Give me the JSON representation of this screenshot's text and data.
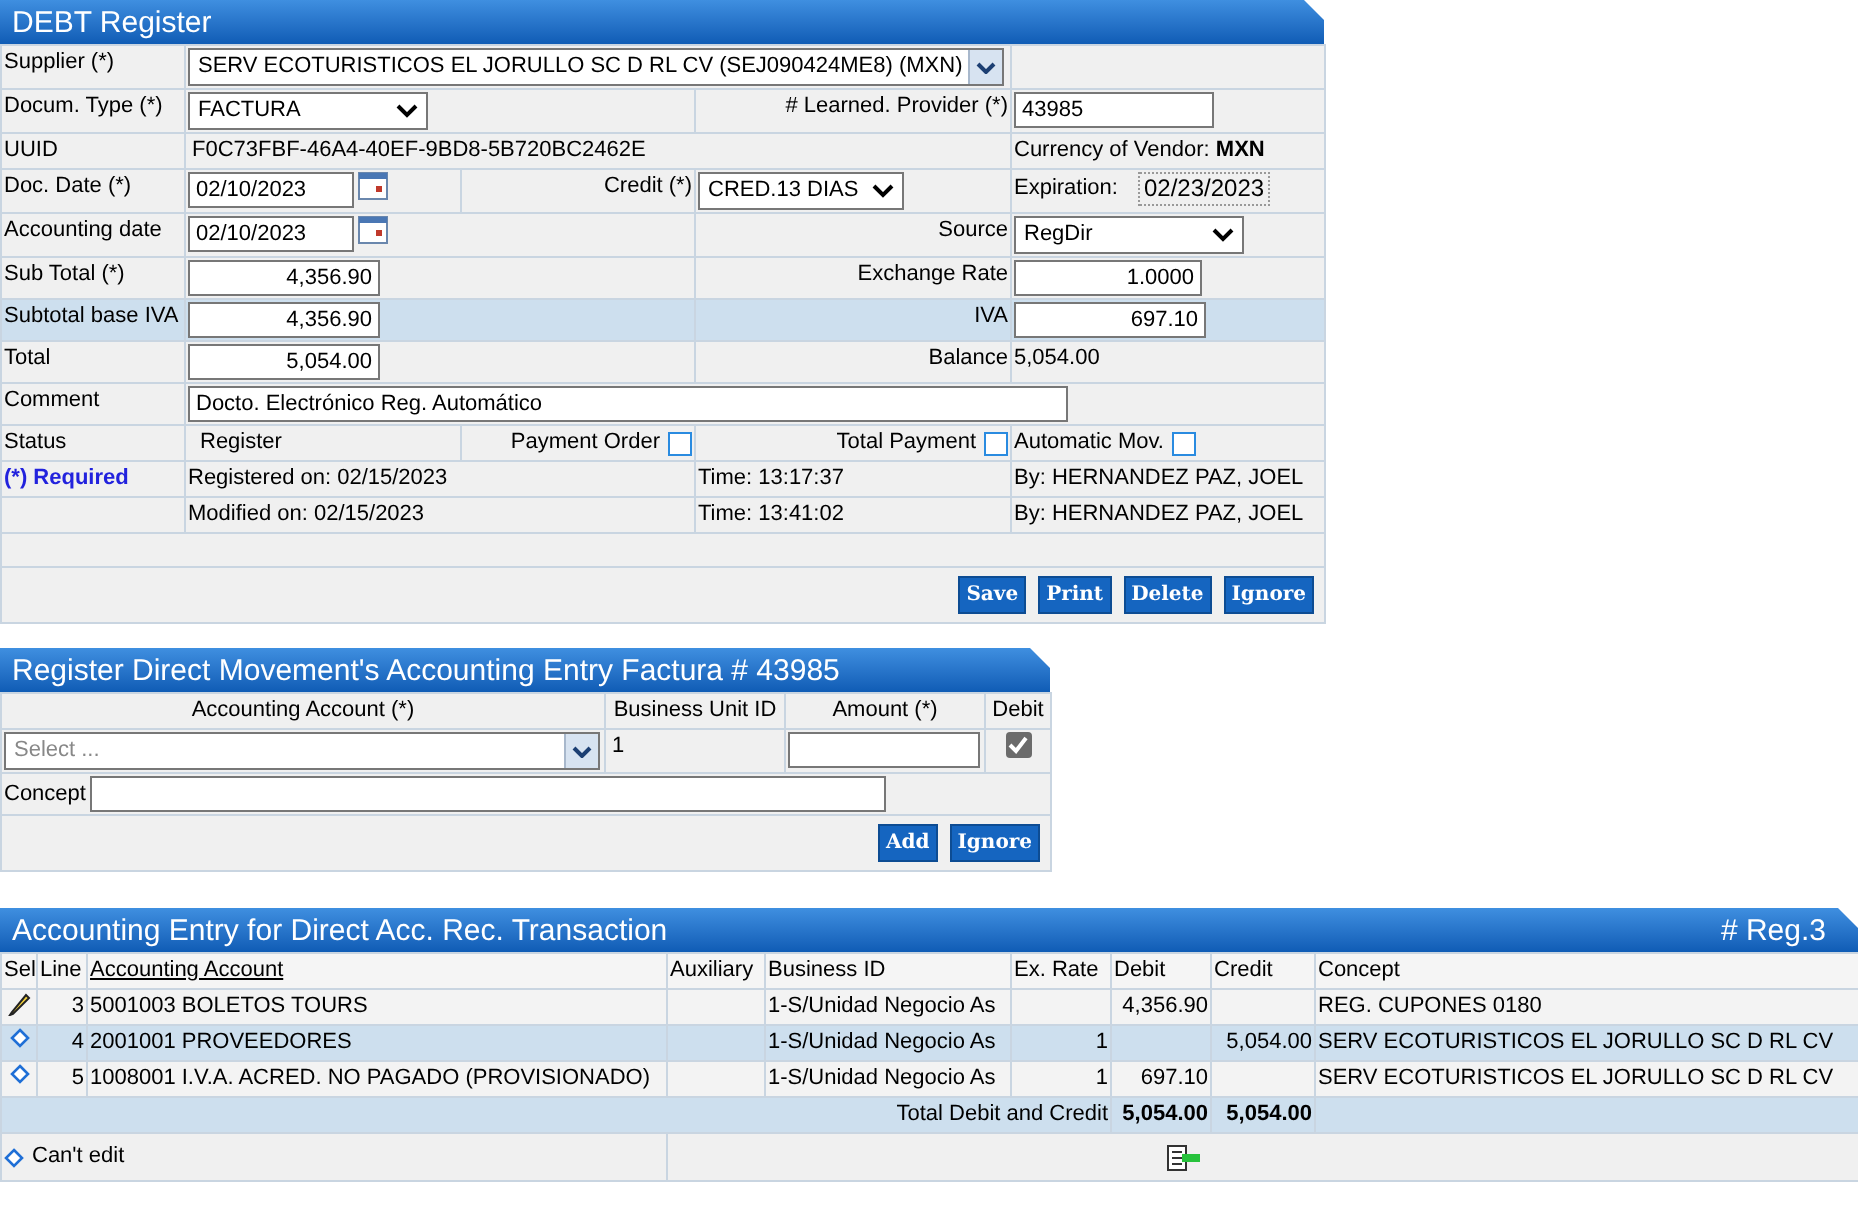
{
  "debt_register": {
    "title": "DEBT Register",
    "supplier": {
      "label": "Supplier (*)",
      "value": "SERV ECOTURISTICOS EL JORULLO SC D RL CV (SEJ090424ME8) (MXN)"
    },
    "document_type": {
      "label": "Docum. Type (*)",
      "value": "FACTURA"
    },
    "provider_number": {
      "label": "# Learned. Provider (*)",
      "value": "43985"
    },
    "uuid": {
      "label": "UUID",
      "value": "F0C73FBF-46A4-40EF-9BD8-5B720BC2462E"
    },
    "currency": {
      "label": "Currency of Vendor:",
      "value": "MXN"
    },
    "doc_date": {
      "label": "Doc. Date (*)",
      "value": "02/10/2023"
    },
    "credit": {
      "label": "Credit (*)",
      "value": "CRED.13 DIAS"
    },
    "expiration": {
      "label": "Expiration:",
      "value": "02/23/2023"
    },
    "accounting_date": {
      "label": "Accounting date",
      "value": "02/10/2023"
    },
    "source": {
      "label": "Source",
      "value": "RegDir"
    },
    "sub_total": {
      "label": "Sub Total (*)",
      "value": "4,356.90"
    },
    "exchange_rate": {
      "label": "Exchange Rate",
      "value": "1.0000"
    },
    "subtotal_base_iva": {
      "label": "Subtotal base IVA",
      "value": "4,356.90"
    },
    "iva": {
      "label": "IVA",
      "value": "697.10"
    },
    "total": {
      "label": "Total",
      "value": "5,054.00"
    },
    "balance": {
      "label": "Balance",
      "value": "5,054.00"
    },
    "comment": {
      "label": "Comment",
      "value": "Docto. Electrónico Reg. Automático"
    },
    "status": {
      "label": "Status",
      "value": "Register"
    },
    "payment_order": {
      "label": "Payment Order",
      "checked": false
    },
    "total_payment": {
      "label": "Total Payment",
      "checked": false
    },
    "automatic_mov": {
      "label": "Automatic Mov.",
      "checked": false
    },
    "required_note": "(*) Required",
    "audit": [
      {
        "label": "Registered on:  02/15/2023",
        "time": "Time:  13:17:37",
        "by": "By:  HERNANDEZ PAZ, JOEL"
      },
      {
        "label": "Modified on:  02/15/2023",
        "time": "Time: 13:41:02",
        "by": "By: HERNANDEZ PAZ, JOEL"
      }
    ],
    "buttons": [
      "Save",
      "Print",
      "Delete",
      "Ignore"
    ]
  },
  "entry_form": {
    "title": "Register Direct Movement's Accounting Entry Factura # 43985",
    "columns": [
      "Accounting Account (*)",
      "Business Unit ID",
      "Amount (*)",
      "Debit"
    ],
    "account": {
      "placeholder": "Select ..."
    },
    "business_unit": "1",
    "debit": {
      "checked": true
    },
    "concept_label": "Concept",
    "buttons": [
      "Add",
      "Ignore"
    ]
  },
  "entries": {
    "title": "Accounting Entry for Direct Acc. Rec. Transaction",
    "counter": "# Reg.3",
    "columns": [
      "Sel",
      "Line",
      "Accounting Account",
      "Auxiliary",
      "Business ID",
      "Ex. Rate",
      "Debit",
      "Credit",
      "Concept"
    ],
    "rows": [
      {
        "kind": "editable",
        "line": "3",
        "account": "5001003 BOLETOS TOURS",
        "business_id": "1-S/Unidad Negocio As",
        "debit": "4,356.90",
        "concept": "REG. CUPONES 0180"
      },
      {
        "kind": "locked",
        "line": "4",
        "account": "2001001 PROVEEDORES",
        "business_id": "1-S/Unidad Negocio As",
        "ex_rate": "1",
        "credit": "5,054.00",
        "concept": "SERV ECOTURISTICOS EL JORULLO SC D RL CV"
      },
      {
        "kind": "locked",
        "line": "5",
        "account": "1008001 I.V.A. ACRED. NO PAGADO (PROVISIONADO)",
        "business_id": "1-S/Unidad Negocio As",
        "ex_rate": "1",
        "debit": "697.10",
        "concept": "SERV ECOTURISTICOS EL JORULLO SC D RL CV"
      }
    ],
    "totals": {
      "label": "Total Debit and Credit",
      "debit": "5,054.00",
      "credit": "5,054.00"
    },
    "legend": {
      "kind": "locked",
      "label": "Can't edit"
    }
  }
}
